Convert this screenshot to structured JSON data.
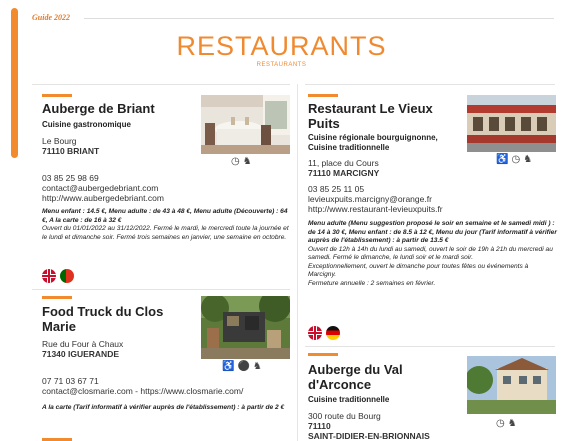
{
  "header": {
    "guide_label": "Guide 2022",
    "title": "RESTAURANTS",
    "subtitle": "RESTAURANTS"
  },
  "left_column": [
    {
      "name": "Auberge de Briant",
      "category": "Cuisine gastronomique",
      "address_line": "Le Bourg",
      "postal_city": "71110 BRIANT",
      "phone": "03 85 25 98 69",
      "email": "contact@aubergedebriant.com",
      "website": "http://www.aubergedebriant.com",
      "pricing_bold": "Menu enfant : 14.5 €, Menu adulte : de 43 à 48 €, Menu adulte (Découverte) : 64 €, A la carte : de 16 à 32 €",
      "pricing_detail": "Ouvert du 01/01/2022 au 31/12/2022. Fermé le mardi, le mercredi toute la journée et le lundi et dimanche soir.  Fermé trois semaines en janvier, une semaine en octobre.",
      "amenities": [
        "wifi-icon",
        "pet-icon"
      ],
      "languages": [
        "English",
        "Portuguese"
      ]
    },
    {
      "name": "Food Truck du Clos Marie",
      "name_line1": "Food Truck du Clos",
      "name_line2": "Marie",
      "address_line": "Rue du Four à Chaux",
      "postal_city": "71340 IGUERANDE",
      "phone": "07 71 03 67 71",
      "contact_line": "contact@closmarie.com - https://www.closmarie.com/",
      "pricing_bold": "A la carte (Tarif informatif à vérifier auprès de l'établissement) : à partir de 2 €",
      "amenities": [
        "accessibility-icon",
        "bike-icon",
        "pet-icon"
      ]
    }
  ],
  "right_column": [
    {
      "name": "Restaurant Le Vieux Puits",
      "name_line1": "Restaurant Le Vieux",
      "name_line2": "Puits",
      "category_line1": "Cuisine régionale bourguignonne,",
      "category_line2": "Cuisine traditionnelle",
      "address_line": "11, place du Cours",
      "postal_city": "71110 MARCIGNY",
      "phone": "03 85 25 11 05",
      "email": "levieuxpuits.marcigny@orange.fr",
      "website": "http://www.restaurant-levieuxpuits.fr",
      "pricing_bold": "Menu adulte (Menu suggestion proposé le soir en semaine et le samedi midi ) : de 14 à 30 €, Menu enfant : de 8.5 à 12 €, Menu du jour (Tarif informatif à vérifier auprès de l'établissement) : à partir de 13.5 €",
      "pricing_detail_1": "Ouvert de 12h à 14h du lundi au samedi, ouvert le soir de 19h à 21h du mercredi au samedi. Fermé le dimanche, le lundi soir et le mardi soir.",
      "pricing_detail_2": "Exceptionnellement, ouvert le dimanche pour toutes fêtes ou événements à Marcigny.",
      "pricing_detail_3": "Fermeture annuelle : 2 semaines en février.",
      "amenities": [
        "accessibility-icon",
        "wifi-icon",
        "pet-icon"
      ],
      "languages": [
        "English",
        "German"
      ]
    },
    {
      "name_line1": "Auberge du Val",
      "name_line2": "d'Arconce",
      "category": "Cuisine traditionnelle",
      "address_line": "300 route du Bourg",
      "postal_code": "71110",
      "city": "SAINT-DIDIER-EN-BRIONNAIS",
      "amenities": [
        "wifi-icon",
        "pet-icon"
      ]
    }
  ],
  "colors": {
    "accent": "#f28a2e",
    "title": "#f08a30"
  }
}
